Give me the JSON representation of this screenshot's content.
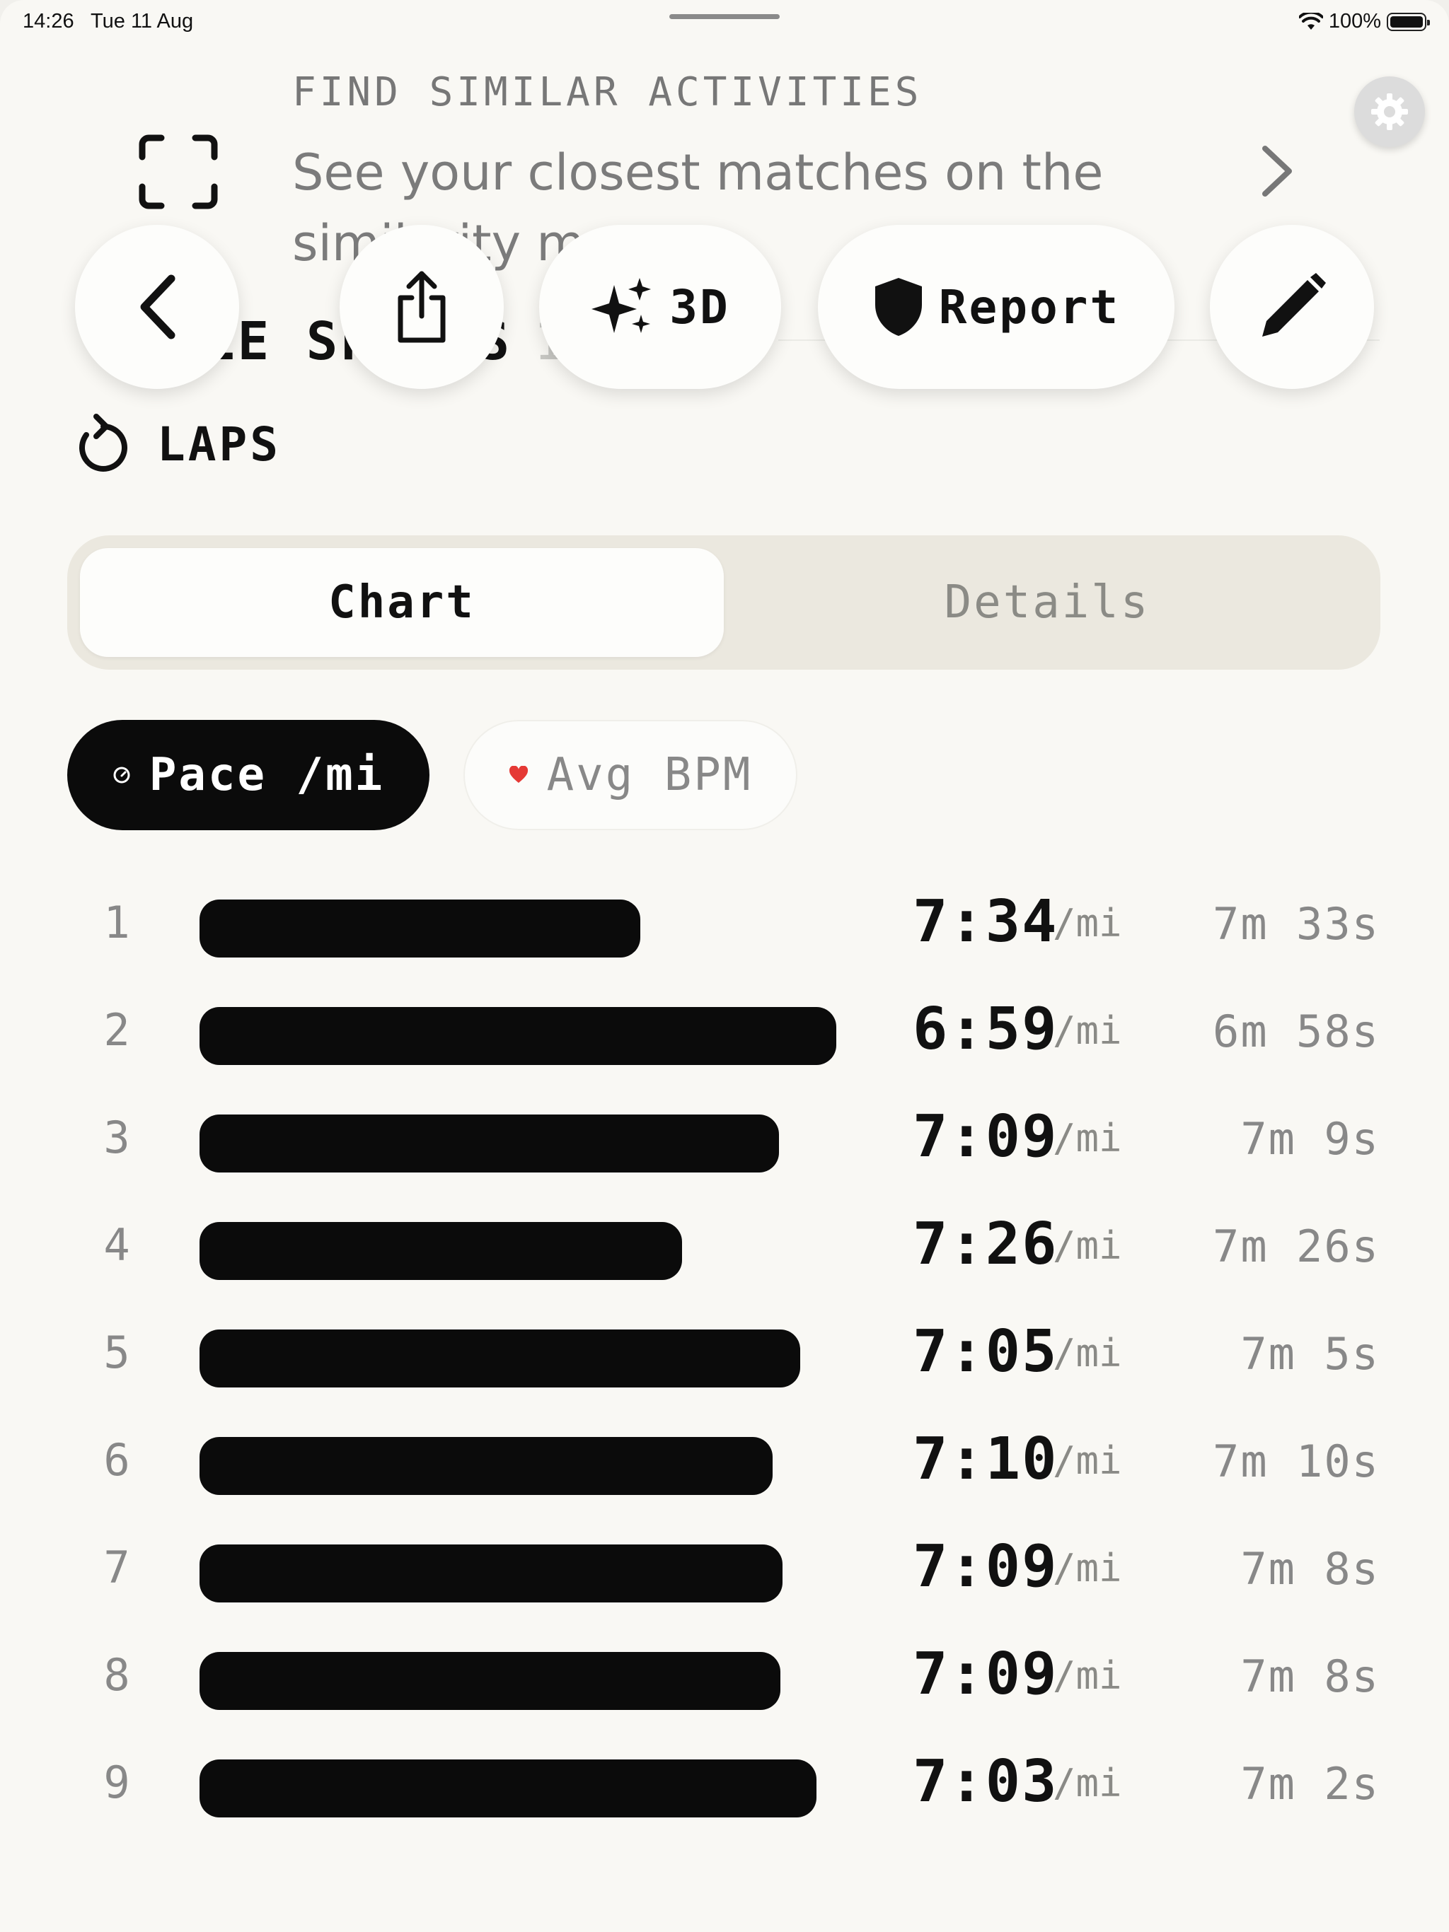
{
  "status_bar": {
    "time": "14:26",
    "date": "Tue 11 Aug",
    "battery": "100%"
  },
  "find_similar": {
    "title": "FIND SIMILAR ACTIVITIES",
    "description": "See your closest matches on the similarity map"
  },
  "splits_section": {
    "title": "MILE SPLITS",
    "count": "10"
  },
  "actions": {
    "three_d": "3D",
    "report": "Report"
  },
  "laps": {
    "label": "LAPS"
  },
  "tabs": {
    "chart": "Chart",
    "details": "Details",
    "selected": "Chart"
  },
  "metrics": {
    "pace": "Pace /mi",
    "bpm": "Avg BPM",
    "selected": "Pace /mi"
  },
  "colors": {
    "accent": "#0b0b0b",
    "heart": "#e53935",
    "muted": "#888888",
    "background": "#f9f8f4"
  },
  "chart_data": {
    "type": "bar",
    "unit": "/mi",
    "rows": [
      {
        "mile": "1",
        "pace": "7:34",
        "unit": "/mi",
        "time": "7m 33s",
        "bar_fraction": 0.537
      },
      {
        "mile": "2",
        "pace": "6:59",
        "unit": "/mi",
        "time": "6m 58s",
        "bar_fraction": 0.776
      },
      {
        "mile": "3",
        "pace": "7:09",
        "unit": "/mi",
        "time": "7m 9s",
        "bar_fraction": 0.706
      },
      {
        "mile": "4",
        "pace": "7:26",
        "unit": "/mi",
        "time": "7m 26s",
        "bar_fraction": 0.588
      },
      {
        "mile": "5",
        "pace": "7:05",
        "unit": "/mi",
        "time": "7m 5s",
        "bar_fraction": 0.732
      },
      {
        "mile": "6",
        "pace": "7:10",
        "unit": "/mi",
        "time": "7m 10s",
        "bar_fraction": 0.698
      },
      {
        "mile": "7",
        "pace": "7:09",
        "unit": "/mi",
        "time": "7m 8s",
        "bar_fraction": 0.71
      },
      {
        "mile": "8",
        "pace": "7:09",
        "unit": "/mi",
        "time": "7m 8s",
        "bar_fraction": 0.708
      },
      {
        "mile": "9",
        "pace": "7:03",
        "unit": "/mi",
        "time": "7m 2s",
        "bar_fraction": 0.752
      }
    ]
  }
}
